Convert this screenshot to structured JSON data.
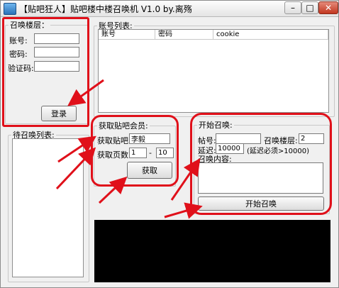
{
  "window": {
    "title": "【贴吧狂人】贴吧楼中楼召唤机 V1.0  by.离殇",
    "min_glyph": "–",
    "max_glyph": "□",
    "close_glyph": "✕"
  },
  "summon_floor": {
    "legend": "召唤楼层：",
    "account_label": "账号:",
    "password_label": "密码:",
    "captcha_label": "验证码:",
    "account_value": "",
    "password_value": "",
    "captcha_value": "",
    "login_button": "登录"
  },
  "account_list": {
    "legend": "账号列表:",
    "columns": [
      "账号",
      "密码",
      "cookie"
    ]
  },
  "pending_list": {
    "legend": "待召唤列表:"
  },
  "fetch_members": {
    "legend": "获取贴吧会员:",
    "forum_label": "获取贴吧:",
    "forum_value": "李毅",
    "pages_label": "获取页数:",
    "page_from": "1",
    "page_dash": "-",
    "page_to": "10",
    "fetch_button": "获取"
  },
  "start_summon": {
    "legend": "开始召唤:",
    "post_label": "帖号:",
    "post_value": "",
    "floor_label": "召唤楼层:",
    "floor_value": "2",
    "delay_label": "延迟:",
    "delay_value": "10000",
    "delay_hint": "(延迟必须>10000)",
    "content_label": "召唤内容:",
    "content_value": "",
    "start_button": "开始召唤"
  },
  "highlight_color": "#e0101a"
}
